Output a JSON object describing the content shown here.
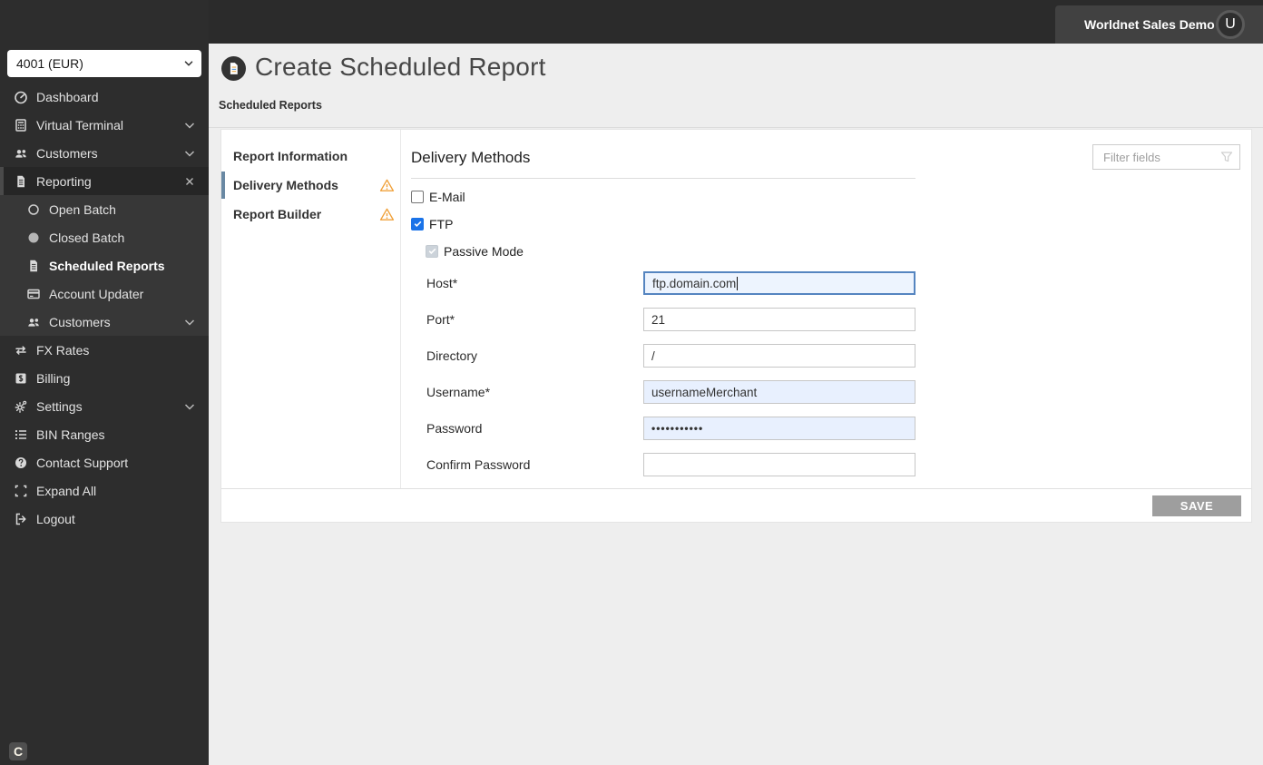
{
  "topbar": {
    "merchant_name": "Worldnet Sales Demo",
    "avatar_letter": "U"
  },
  "sidebar": {
    "terminal_select": {
      "value": "4001 (EUR)"
    },
    "items": [
      {
        "label": "Dashboard",
        "icon": "dashboard-icon",
        "level": "main"
      },
      {
        "label": "Virtual Terminal",
        "icon": "virtual-terminal-icon",
        "level": "main",
        "trailing": "chevron"
      },
      {
        "label": "Customers",
        "icon": "customers-icon",
        "level": "main",
        "trailing": "chevron"
      },
      {
        "label": "Reporting",
        "icon": "reporting-icon",
        "level": "main",
        "trailing": "close",
        "active": true
      },
      {
        "label": "Open Batch",
        "icon": "open-batch-icon",
        "level": "sub"
      },
      {
        "label": "Closed Batch",
        "icon": "closed-batch-icon",
        "level": "sub"
      },
      {
        "label": "Scheduled Reports",
        "icon": "scheduled-reports-icon",
        "level": "sub",
        "selected": true
      },
      {
        "label": "Account Updater",
        "icon": "account-updater-icon",
        "level": "sub"
      },
      {
        "label": "Customers",
        "icon": "customers-icon",
        "level": "sub",
        "trailing": "chevron"
      },
      {
        "label": "FX Rates",
        "icon": "fx-rates-icon",
        "level": "main"
      },
      {
        "label": "Billing",
        "icon": "billing-icon",
        "level": "main"
      },
      {
        "label": "Settings",
        "icon": "settings-icon",
        "level": "main",
        "trailing": "chevron"
      },
      {
        "label": "BIN Ranges",
        "icon": "bin-ranges-icon",
        "level": "main"
      },
      {
        "label": "Contact Support",
        "icon": "contact-support-icon",
        "level": "main"
      },
      {
        "label": "Expand All",
        "icon": "expand-all-icon",
        "level": "main"
      },
      {
        "label": "Logout",
        "icon": "logout-icon",
        "level": "main"
      }
    ],
    "footer_logo": "C"
  },
  "header": {
    "title": "Create Scheduled Report",
    "breadcrumb": "Scheduled Reports"
  },
  "panel": {
    "subnav": [
      {
        "label": "Report Information",
        "active": false,
        "warning": false
      },
      {
        "label": "Delivery Methods",
        "active": true,
        "warning": true
      },
      {
        "label": "Report Builder",
        "active": false,
        "warning": true
      }
    ],
    "section_title": "Delivery Methods",
    "filter": {
      "placeholder": "Filter fields"
    },
    "checkboxes": [
      {
        "label": "E-Mail",
        "checked": false
      },
      {
        "label": "FTP",
        "checked": true
      },
      {
        "label": "Passive Mode",
        "checked": true,
        "disabled": true,
        "indent": true
      }
    ],
    "fields": [
      {
        "label": "Host*",
        "value": "ftp.domain.com",
        "state": "focused"
      },
      {
        "label": "Port*",
        "value": "21",
        "state": "normal"
      },
      {
        "label": "Directory",
        "value": "/",
        "state": "normal"
      },
      {
        "label": "Username*",
        "value": "usernameMerchant",
        "state": "autofill"
      },
      {
        "label": "Password",
        "value": "•••••••••••",
        "state": "autofill",
        "type": "password"
      },
      {
        "label": "Confirm Password",
        "value": "",
        "state": "normal"
      }
    ],
    "save_label": "SAVE"
  },
  "colors": {
    "accent": "#1a73e8",
    "warning": "#f0a13a",
    "focus": "#5585c0",
    "focus_bg": "#edf4fe",
    "autofill_bg": "#e8f0fe",
    "save_bg": "#9e9e9e",
    "active_bar": "#6988a3",
    "sidebar_bg": "#2d2d2d",
    "submenu_bg": "#373737",
    "topbar_bg": "#2b2b2b",
    "page_bg": "#eeeeee"
  }
}
